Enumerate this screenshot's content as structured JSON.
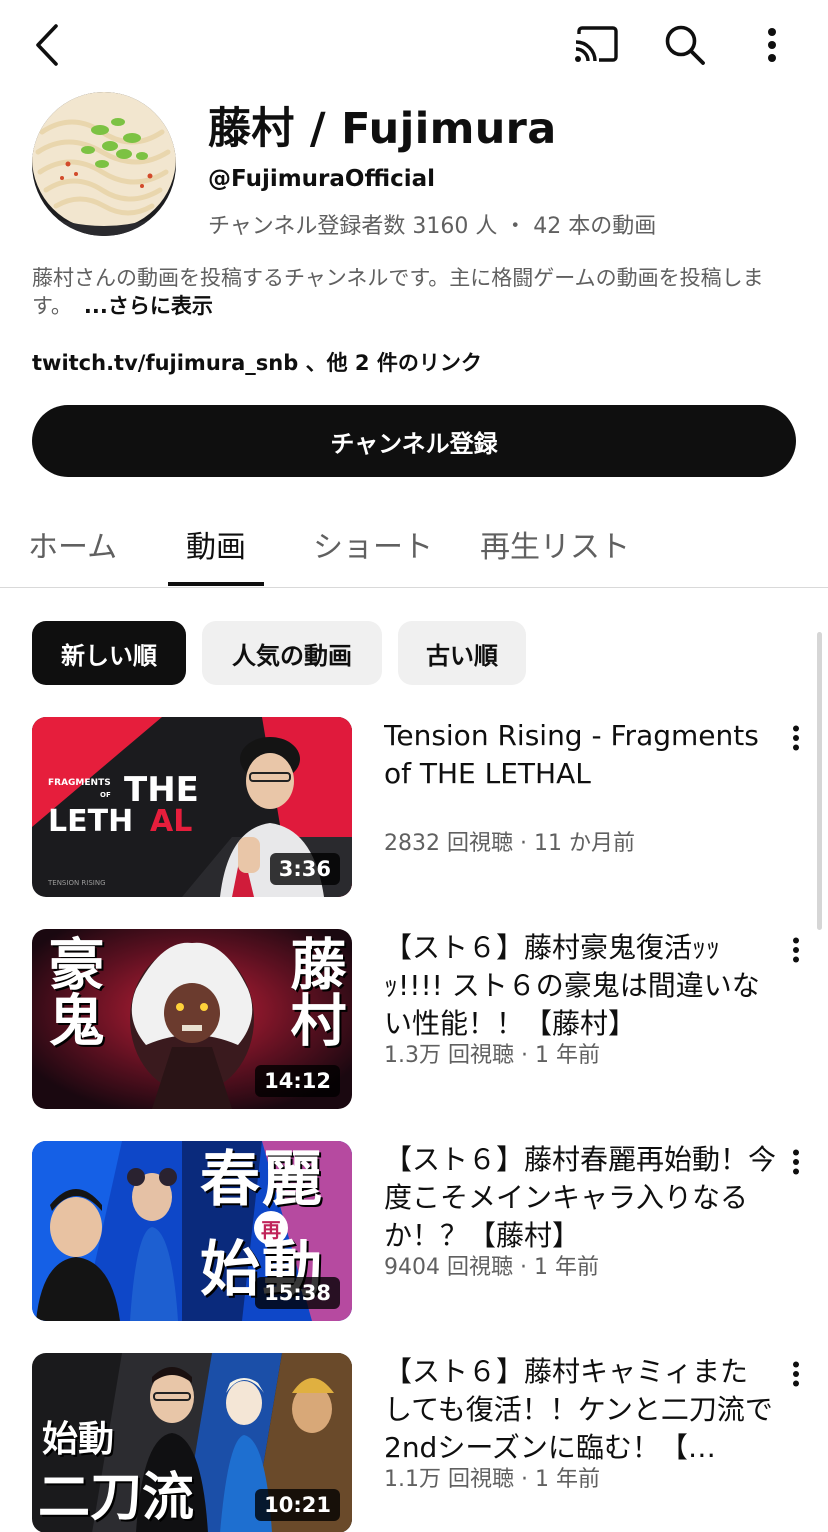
{
  "channel": {
    "name": "藤村 / Fujimura",
    "handle": "@FujimuraOfficial",
    "meta": "チャンネル登録者数 3160 人 ・ 42 本の動画",
    "description": "藤村さんの動画を投稿するチャンネルです。主に格闘ゲームの動画を投稿します。",
    "description_more": "...さらに表示",
    "links": "twitch.tv/fujimura_snb 、他 2 件のリンク",
    "subscribe_label": "チャンネル登録"
  },
  "icons": {
    "back": "back-arrow-icon",
    "cast": "cast-icon",
    "search": "search-icon",
    "more": "more-vert-icon"
  },
  "tabs": [
    {
      "label": "ホーム",
      "active": false
    },
    {
      "label": "動画",
      "active": true
    },
    {
      "label": "ショート",
      "active": false
    },
    {
      "label": "再生リスト",
      "active": false
    }
  ],
  "sort_chips": [
    {
      "label": "新しい順",
      "selected": true
    },
    {
      "label": "人気の動画",
      "selected": false
    },
    {
      "label": "古い順",
      "selected": false
    }
  ],
  "videos": [
    {
      "title": "Tension Rising - Fragments of THE LETHAL",
      "meta": "2832 回視聴 · 11 か月前",
      "duration": "3:36",
      "thumb_text": "FRAGMENTS OF THE LETHAL",
      "thumb_caption": "TENSION RISING"
    },
    {
      "title": "【スト６】藤村豪鬼復活ｯｯｯ!!!! スト６の豪鬼は間違いない性能！！【藤村】",
      "meta": "1.3万 回視聴 · 1 年前",
      "duration": "14:12",
      "thumb_text_left": "豪鬼",
      "thumb_text_right": "藤村"
    },
    {
      "title": "【スト６】藤村春麗再始動！今度こそメインキャラ入りなるか！？【藤村】",
      "meta": "9404 回視聴 · 1 年前",
      "duration": "15:38",
      "thumb_text_top": "春麗",
      "thumb_text_bottom": "始動",
      "thumb_badge": "再"
    },
    {
      "title": "【スト６】藤村キャミィまたしても復活！！ケンと二刀流で2ndシーズンに臨む！【…",
      "meta": "1.1万 回視聴 · 1 年前",
      "duration": "10:21",
      "thumb_text_top": "始動",
      "thumb_text_bottom": "二刀流"
    }
  ]
}
